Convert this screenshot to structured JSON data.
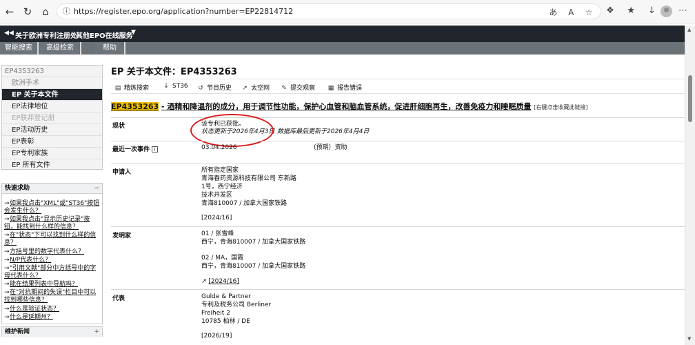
{
  "browser": {
    "url": "https://register.epo.org/application?number=EP22814712"
  },
  "epo_nav": {
    "link_about": "关于欧洲专利注册处",
    "link_services": "其他EPO在线服务",
    "tabs": [
      "智能搜索",
      "高级检索",
      "帮助"
    ]
  },
  "sidebar": {
    "case_number": "EP4353263",
    "items": [
      {
        "label": "欧洲手术",
        "state": "sub"
      },
      {
        "label": "EP 关于本文件",
        "state": "active"
      },
      {
        "label": "EP法律地位",
        "state": "normal"
      },
      {
        "label": "EP联邦登记册",
        "state": "disabled"
      },
      {
        "label": "EP活动历史",
        "state": "normal"
      },
      {
        "label": "EP表彰",
        "state": "normal"
      },
      {
        "label": "EP专利家族",
        "state": "normal"
      },
      {
        "label": "EP 所有文件",
        "state": "normal"
      }
    ]
  },
  "quick_help": {
    "title": "快速求助",
    "toggle": "−",
    "links": [
      "如果我点击\"XML\"或\"ST36\"按钮会发生什么？",
      "如果我点击\"显示历史记录\"按钮，能找到什么样的信息？",
      "在\"状态\"下可以找到什么样的信息？",
      "方括号里的数字代表什么？",
      "N/P代表什么？",
      "\"引用文献\"部分中方括号中的字母代表什么？",
      "能在结果列表中导航吗？",
      "在\"对抗期间的失误\"栏目中可以找到哪些信息？",
      "什么是验证状态？",
      "什么是延期州？"
    ]
  },
  "news": {
    "title": "维护新闻",
    "toggle": "+"
  },
  "main": {
    "page_title": "EP 关于本文件：EP4353263",
    "toolbar": [
      {
        "label": "精炼搜索",
        "icon": "search-icon"
      },
      {
        "label": "ST36",
        "icon": "download-icon"
      },
      {
        "label": "节目历史",
        "icon": "history-icon"
      },
      {
        "label": "太空网",
        "icon": "external-link-icon"
      },
      {
        "label": "提交观察",
        "icon": "edit-icon"
      },
      {
        "label": "报告错误",
        "icon": "error-report-icon"
      }
    ],
    "doc_number": "EP4353263",
    "doc_title": "- 酒精和降温剂的成分，用于调节性功能，保护心血管和脑血管系统，促进肝细胞再生，改善免疫力和睡眠质量",
    "doc_hint": "[右键点击收藏此链接]",
    "status": {
      "label": "现状",
      "value": "该专利已获批。",
      "updated": "状态更新于2026年4月3日",
      "db_updated": "数据库最后更新于2026年4月4日"
    },
    "last_event": {
      "label": "最近一次事件",
      "info": "i",
      "date": "03.04.2026",
      "text": "(预期）资助"
    },
    "applicant": {
      "label": "申请人",
      "lines": [
        "所有指定国家",
        "青海春药资源科技有限公司 东新路",
        "1号，西宁经济",
        "技术开发区",
        "青海810007 / 加拿大国家铁路"
      ],
      "ref": "[2024/16]"
    },
    "inventor": {
      "label": "发明家",
      "entries": [
        {
          "lines": [
            "01 / 张雪峰",
            "西宁，青海810007 / 加拿大国家铁路"
          ]
        },
        {
          "lines": [
            "02 / MA，国霞",
            "西宁，青海810007 / 加拿大国家铁路"
          ]
        }
      ],
      "ref": "[2024/16]"
    },
    "representative": {
      "label": "代表",
      "lines": [
        "Gulde & Partner",
        "专利及税务公司 Berliner",
        "Freiheit 2",
        "10785 柏林 / DE"
      ],
      "ref": "[2026/19]"
    }
  }
}
